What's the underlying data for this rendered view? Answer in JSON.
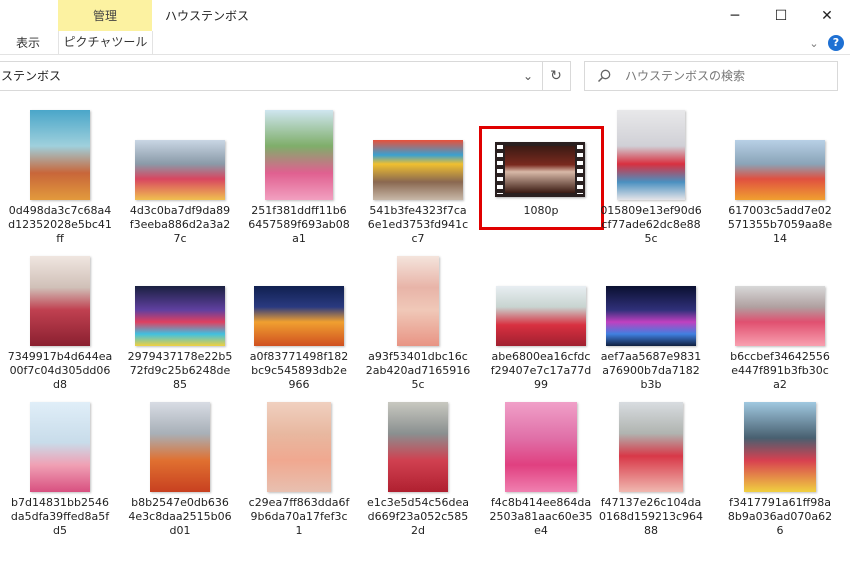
{
  "window": {
    "title": "ハウステンボス",
    "manage_tab": "管理",
    "tabs": [
      "表示",
      "ピクチャツール"
    ],
    "minimize": "─",
    "maximize": "☐",
    "close": "✕",
    "help": "?"
  },
  "address": {
    "path": "ステンボス",
    "dropdown": "⌄",
    "refresh": "↻"
  },
  "search": {
    "placeholder": "ハウステンボスの検索"
  },
  "highlight_color": "#e00000",
  "manage_color": "#fcf2a1",
  "files": [
    {
      "lines": [
        "0d498da3c7c68a4",
        "d12352028e5bc41",
        "ff"
      ],
      "kind": "photo"
    },
    {
      "lines": [
        "4d3c0ba7df9da89",
        "f3eeba886d2a3a2",
        "7c"
      ],
      "kind": "photo"
    },
    {
      "lines": [
        "251f381ddff11b6",
        "6457589f693ab08",
        "a1"
      ],
      "kind": "photo"
    },
    {
      "lines": [
        "541b3fe4323f7ca",
        "6e1ed3753fd941c",
        "c7"
      ],
      "kind": "photo"
    },
    {
      "lines": [
        "1080p"
      ],
      "kind": "video"
    },
    {
      "lines": [
        "015809e13ef90d6",
        "cf77ade62dc8e88",
        "5c"
      ],
      "kind": "photo"
    },
    {
      "lines": [
        "617003c5add7e02",
        "571355b7059aa8e",
        "14"
      ],
      "kind": "photo"
    },
    {
      "lines": [
        "7349917b4d644ea",
        "00f7c04d305dd06",
        "d8"
      ],
      "kind": "photo"
    },
    {
      "lines": [
        "2979437178e22b5",
        "72fd9c25b6248de",
        "85"
      ],
      "kind": "photo"
    },
    {
      "lines": [
        "a0f83771498f182",
        "bc9c545893db2e",
        "966"
      ],
      "kind": "photo"
    },
    {
      "lines": [
        "a93f53401dbc16c",
        "2ab420ad7165916",
        "5c"
      ],
      "kind": "photo"
    },
    {
      "lines": [
        "abe6800ea16cfdc",
        "f29407e7c17a77d",
        "99"
      ],
      "kind": "photo"
    },
    {
      "lines": [
        "aef7aa5687e9831",
        "a76900b7da7182",
        "b3b"
      ],
      "kind": "photo"
    },
    {
      "lines": [
        "b6ccbef34642556",
        "e447f891b3fb30c",
        "a2"
      ],
      "kind": "photo"
    },
    {
      "lines": [
        "b7d14831bb2546",
        "da5dfa39ffed8a5f",
        "d5"
      ],
      "kind": "photo"
    },
    {
      "lines": [
        "b8b2547e0db636",
        "4e3c8daa2515b06",
        "d01"
      ],
      "kind": "photo"
    },
    {
      "lines": [
        "c29ea7ff863dda6f",
        "9b6da70a17fef3c",
        "1"
      ],
      "kind": "photo"
    },
    {
      "lines": [
        "e1c3e5d54c56dea",
        "d669f23a052c585",
        "2d"
      ],
      "kind": "photo"
    },
    {
      "lines": [
        "f4c8b414ee864da",
        "2503a81aac60e35",
        "e4"
      ],
      "kind": "photo"
    },
    {
      "lines": [
        "f47137e26c104da",
        "0168d159213c964",
        "88"
      ],
      "kind": "photo"
    },
    {
      "lines": [
        "f3417791a61ff98a",
        "8b9a036ad070a62",
        "6"
      ],
      "kind": "photo"
    }
  ]
}
